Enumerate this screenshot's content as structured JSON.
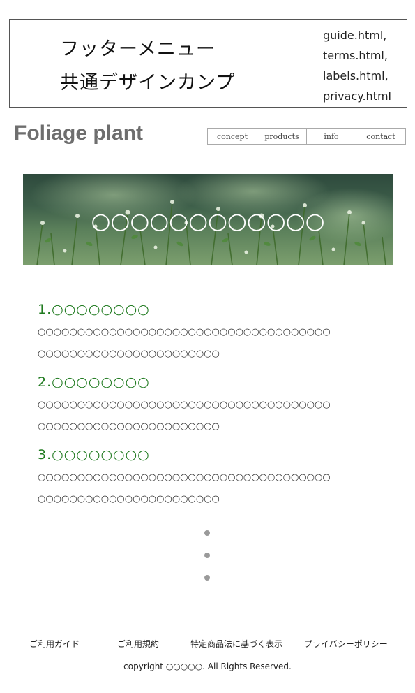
{
  "header_box": {
    "title_line1": "フッターメニュー",
    "title_line2": "共通デザインカンプ",
    "files": [
      "guide.html,",
      "terms.html,",
      "labels.html,",
      "privacy.html"
    ]
  },
  "logo": "Foliage plant",
  "nav": [
    "concept",
    "products",
    "info",
    "contact"
  ],
  "hero": {
    "text": "○○○○○○○○○○○○"
  },
  "sections": [
    {
      "title": "1.○○○○○○○○",
      "line1": "○○○○○○○○○○○○○○○○○○○○○○○○○○○○○○○○○○○○○",
      "line2": "○○○○○○○○○○○○○○○○○○○○○○○"
    },
    {
      "title": "2.○○○○○○○○",
      "line1": "○○○○○○○○○○○○○○○○○○○○○○○○○○○○○○○○○○○○○",
      "line2": "○○○○○○○○○○○○○○○○○○○○○○○"
    },
    {
      "title": "3.○○○○○○○○",
      "line1": "○○○○○○○○○○○○○○○○○○○○○○○○○○○○○○○○○○○○○",
      "line2": "○○○○○○○○○○○○○○○○○○○○○○○"
    }
  ],
  "footer": {
    "links": [
      "ご利用ガイド",
      "ご利用規約",
      "特定商品法に基づく表示",
      "プライバシーポリシー"
    ],
    "copyright": "copyright ○○○○○. All Rights Reserved."
  },
  "colors": {
    "accent_green": "#1f7a1f",
    "logo_gray": "#6e6e6e",
    "dots": "#9a9a9a"
  }
}
